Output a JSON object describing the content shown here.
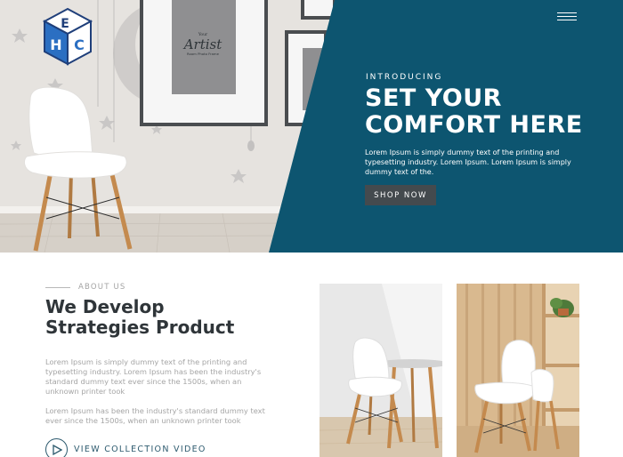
{
  "hero": {
    "eyebrow": "INTRODUCING",
    "title_line1": "SET YOUR",
    "title_line2": "COMFORT HERE",
    "description": "Lorem Ipsum is simply dummy text of the printing and typesetting industry. Lorem Ipsum. Lorem Ipsum is simply dummy text of the.",
    "button_label": "SHOP NOW",
    "frame_text_small": "Your",
    "frame_text_main": "Artist",
    "frame_text_sub": "Room Photo Frame",
    "accent_color": "#0d5570",
    "button_color": "#444a4e"
  },
  "about": {
    "eyebrow": "ABOUT US",
    "title_line1": "We Develop",
    "title_line2": "Strategies Product",
    "paragraph1": "Lorem Ipsum is simply dummy text of the printing and typesetting industry. Lorem Ipsum has been the industry's standard dummy text ever since the 1500s, when an unknown printer took",
    "paragraph2": "Lorem Ipsum has been the industry's standard dummy text ever since the 1500s, when an unknown printer took",
    "video_label": "VIEW COLLECTION VIDEO"
  },
  "icons": {
    "logo": "cube-logo-icon",
    "menu": "hamburger-menu-icon",
    "play": "play-icon"
  }
}
